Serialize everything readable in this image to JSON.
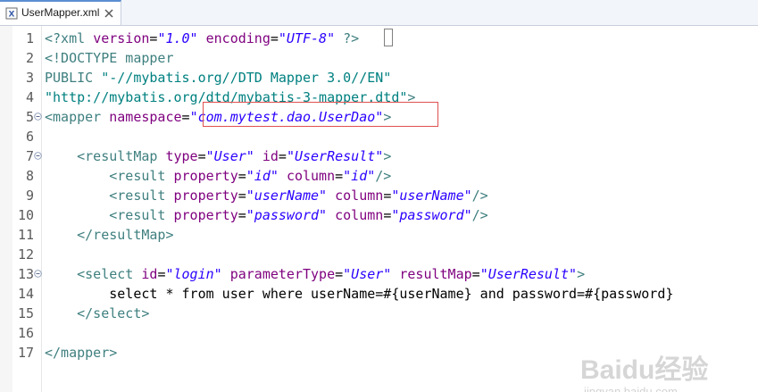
{
  "tab": {
    "title": "UserMapper.xml",
    "icon": "xml-file-icon",
    "close_icon": "close-icon"
  },
  "colors": {
    "tag": "#3f7f7f",
    "attribute": "#7f007f",
    "value": "#2a00ff",
    "highlight": "#e05050"
  },
  "lines": [
    {
      "n": "1",
      "fold": false,
      "tokens": [
        [
          "t-decl",
          "<?xml "
        ],
        [
          "t-attr",
          "version"
        ],
        [
          "t-text",
          "="
        ],
        [
          "t-val",
          "\"1.0\""
        ],
        [
          "t-text",
          " "
        ],
        [
          "t-attr",
          "encoding"
        ],
        [
          "t-text",
          "="
        ],
        [
          "t-val",
          "\"UTF-8\""
        ],
        [
          "t-text",
          " "
        ],
        [
          "t-decl",
          "?>"
        ]
      ]
    },
    {
      "n": "2",
      "fold": false,
      "tokens": [
        [
          "t-doctype",
          "<!DOCTYPE mapper"
        ]
      ]
    },
    {
      "n": "3",
      "fold": false,
      "tokens": [
        [
          "t-doctype",
          "PUBLIC "
        ],
        [
          "t-doc",
          "\"-//mybatis.org//DTD Mapper 3.0//EN\""
        ]
      ]
    },
    {
      "n": "4",
      "fold": false,
      "tokens": [
        [
          "t-doc",
          "\"http://mybatis.org/dtd/mybatis-3-mapper.dtd\""
        ],
        [
          "t-doctype",
          ">"
        ]
      ]
    },
    {
      "n": "5",
      "fold": true,
      "tokens": [
        [
          "t-tag",
          "<mapper "
        ],
        [
          "t-attr",
          "namespace"
        ],
        [
          "t-text",
          "="
        ],
        [
          "t-val",
          "\"com.mytest.dao.UserDao\""
        ],
        [
          "t-tag",
          ">"
        ]
      ]
    },
    {
      "n": "6",
      "fold": false,
      "tokens": []
    },
    {
      "n": "7",
      "fold": true,
      "tokens": [
        [
          "t-text",
          "    "
        ],
        [
          "t-tag",
          "<resultMap "
        ],
        [
          "t-attr",
          "type"
        ],
        [
          "t-text",
          "="
        ],
        [
          "t-val",
          "\"User\""
        ],
        [
          "t-text",
          " "
        ],
        [
          "t-attr",
          "id"
        ],
        [
          "t-text",
          "="
        ],
        [
          "t-val",
          "\"UserResult\""
        ],
        [
          "t-tag",
          ">"
        ]
      ]
    },
    {
      "n": "8",
      "fold": false,
      "tokens": [
        [
          "t-text",
          "        "
        ],
        [
          "t-tag",
          "<result "
        ],
        [
          "t-attr",
          "property"
        ],
        [
          "t-text",
          "="
        ],
        [
          "t-val",
          "\"id\""
        ],
        [
          "t-text",
          " "
        ],
        [
          "t-attr",
          "column"
        ],
        [
          "t-text",
          "="
        ],
        [
          "t-val",
          "\"id\""
        ],
        [
          "t-tag",
          "/>"
        ]
      ]
    },
    {
      "n": "9",
      "fold": false,
      "tokens": [
        [
          "t-text",
          "        "
        ],
        [
          "t-tag",
          "<result "
        ],
        [
          "t-attr",
          "property"
        ],
        [
          "t-text",
          "="
        ],
        [
          "t-val",
          "\"userName\""
        ],
        [
          "t-text",
          " "
        ],
        [
          "t-attr",
          "column"
        ],
        [
          "t-text",
          "="
        ],
        [
          "t-val",
          "\"userName\""
        ],
        [
          "t-tag",
          "/>"
        ]
      ]
    },
    {
      "n": "10",
      "fold": false,
      "tokens": [
        [
          "t-text",
          "        "
        ],
        [
          "t-tag",
          "<result "
        ],
        [
          "t-attr",
          "property"
        ],
        [
          "t-text",
          "="
        ],
        [
          "t-val",
          "\"password\""
        ],
        [
          "t-text",
          " "
        ],
        [
          "t-attr",
          "column"
        ],
        [
          "t-text",
          "="
        ],
        [
          "t-val",
          "\"password\""
        ],
        [
          "t-tag",
          "/>"
        ]
      ]
    },
    {
      "n": "11",
      "fold": false,
      "tokens": [
        [
          "t-text",
          "    "
        ],
        [
          "t-tag",
          "</resultMap>"
        ]
      ]
    },
    {
      "n": "12",
      "fold": false,
      "tokens": []
    },
    {
      "n": "13",
      "fold": true,
      "tokens": [
        [
          "t-text",
          "    "
        ],
        [
          "t-tag",
          "<select "
        ],
        [
          "t-attr",
          "id"
        ],
        [
          "t-text",
          "="
        ],
        [
          "t-val",
          "\"login\""
        ],
        [
          "t-text",
          " "
        ],
        [
          "t-attr",
          "parameterType"
        ],
        [
          "t-text",
          "="
        ],
        [
          "t-val",
          "\"User\""
        ],
        [
          "t-text",
          " "
        ],
        [
          "t-attr",
          "resultMap"
        ],
        [
          "t-text",
          "="
        ],
        [
          "t-val",
          "\"UserResult\""
        ],
        [
          "t-tag",
          ">"
        ]
      ]
    },
    {
      "n": "14",
      "fold": false,
      "tokens": [
        [
          "t-text",
          "        select * from user where userName=#{userName} and password=#{password}"
        ]
      ]
    },
    {
      "n": "15",
      "fold": false,
      "tokens": [
        [
          "t-text",
          "    "
        ],
        [
          "t-tag",
          "</select>"
        ]
      ]
    },
    {
      "n": "16",
      "fold": false,
      "tokens": []
    },
    {
      "n": "17",
      "fold": false,
      "tokens": [
        [
          "t-tag",
          "</mapper>"
        ]
      ]
    }
  ],
  "watermark": {
    "main": "Baidu经验",
    "sub": "jingyan.baidu.com"
  }
}
